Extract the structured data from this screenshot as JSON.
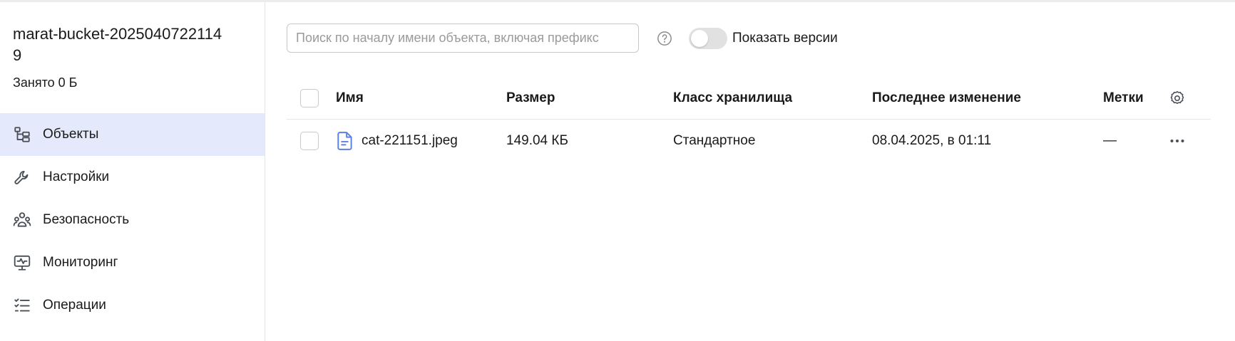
{
  "sidebar": {
    "bucket_name": "marat-bucket-20250407221149",
    "used": "Занято 0 Б",
    "items": [
      {
        "label": "Объекты",
        "icon": "tree-icon",
        "active": true
      },
      {
        "label": "Настройки",
        "icon": "wrench-icon",
        "active": false
      },
      {
        "label": "Безопасность",
        "icon": "users-icon",
        "active": false
      },
      {
        "label": "Мониторинг",
        "icon": "monitor-icon",
        "active": false
      },
      {
        "label": "Операции",
        "icon": "checklist-icon",
        "active": false
      }
    ]
  },
  "toolbar": {
    "search_placeholder": "Поиск по началу имени объекта, включая префикс",
    "search_value": "",
    "versions_label": "Показать версии",
    "versions_enabled": false
  },
  "table": {
    "columns": {
      "name": "Имя",
      "size": "Размер",
      "storage_class": "Класс хранилища",
      "modified": "Последнее изменение",
      "labels": "Метки"
    },
    "rows": [
      {
        "name": "cat-221151.jpeg",
        "size": "149.04 КБ",
        "storage_class": "Стандартное",
        "modified": "08.04.2025, в 01:11",
        "labels": "—"
      }
    ]
  },
  "colors": {
    "accent_active_bg": "#e4eafb",
    "file_icon": "#5b7fe6",
    "icon_gray": "#4a4f57"
  }
}
